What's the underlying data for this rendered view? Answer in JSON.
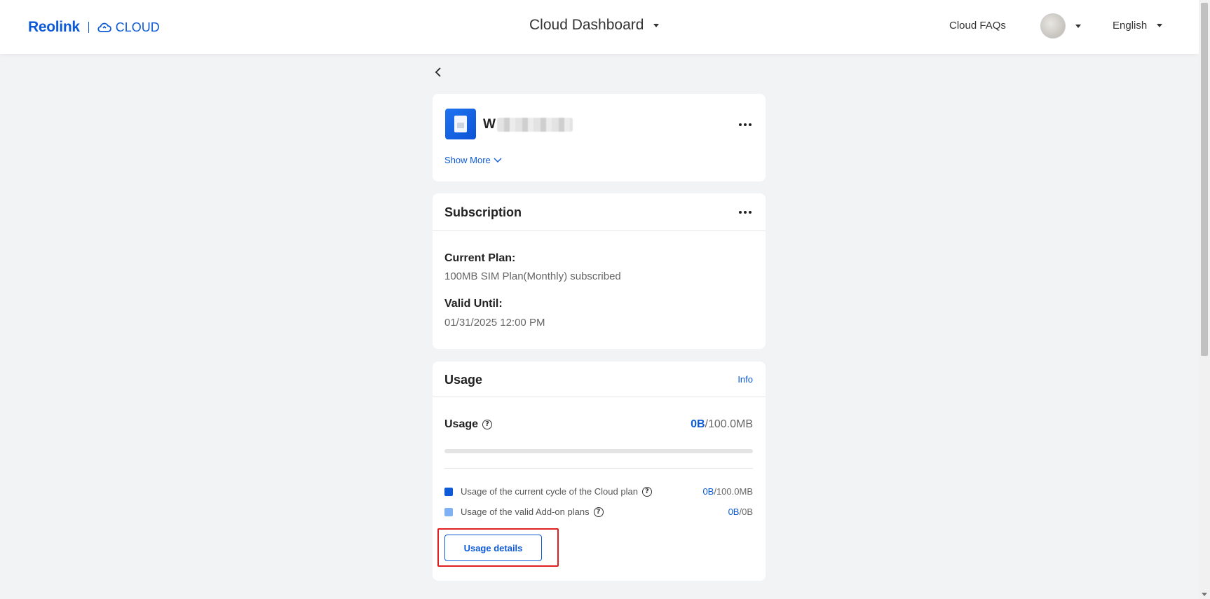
{
  "header": {
    "brand": "Reolink",
    "cloud_label": "CLOUD",
    "title": "Cloud Dashboard",
    "faq": "Cloud FAQs",
    "language": "English"
  },
  "device": {
    "name_visible": "W",
    "show_more": "Show More"
  },
  "subscription": {
    "title": "Subscription",
    "current_plan_label": "Current Plan:",
    "current_plan_value": "100MB SIM Plan(Monthly) subscribed",
    "valid_until_label": "Valid Until:",
    "valid_until_value": "01/31/2025 12:00 PM"
  },
  "usage": {
    "title": "Usage",
    "info_link": "Info",
    "usage_label": "Usage",
    "used": "0B",
    "total": "/100.0MB",
    "progress_fraction": 0,
    "rows": [
      {
        "label": "Usage of the current cycle of the Cloud plan",
        "used": "0B",
        "total": "/100.0MB",
        "color": "#0d5ad8"
      },
      {
        "label": "Usage of the valid Add-on plans",
        "used": "0B",
        "total": "/0B",
        "color": "#7fb2f5"
      }
    ],
    "details_button": "Usage details"
  },
  "colors": {
    "accent": "#0d5ad8",
    "highlight": "#e02020"
  }
}
